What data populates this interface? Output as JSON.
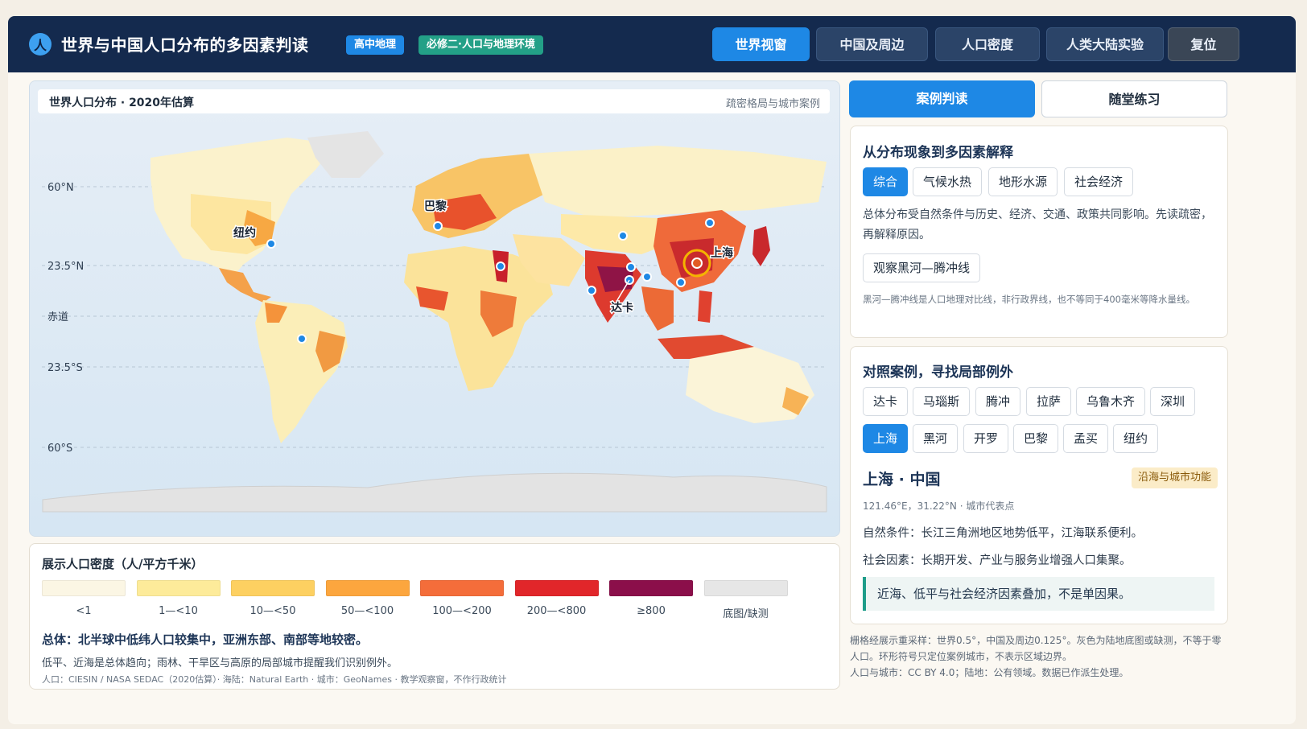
{
  "header": {
    "logo_glyph": "人",
    "title": "世界与中国人口分布的多因素判读",
    "badge_grade": "高中地理",
    "badge_unit": "必修二·人口与地理环境",
    "nav": [
      "世界视窗",
      "中国及周边",
      "人口密度",
      "人类大陆实验"
    ],
    "reset": "复位"
  },
  "map": {
    "title": "世界人口分布 · 2020年估算",
    "subtitle": "疏密格局与城市案例",
    "lat_labels": [
      "60°N",
      "23.5°N",
      "赤道",
      "23.5°S",
      "60°S"
    ],
    "city_labels": [
      "巴黎",
      "纽约",
      "上海",
      "达卡"
    ]
  },
  "legend": {
    "title": "展示人口密度（人/平方千米）",
    "classes": [
      {
        "label": "<1",
        "color": "#fbf6e4"
      },
      {
        "label": "1—<10",
        "color": "#fdeb9a"
      },
      {
        "label": "10—<50",
        "color": "#fdd061"
      },
      {
        "label": "50—<100",
        "color": "#fca63e"
      },
      {
        "label": "100—<200",
        "color": "#f46d3a"
      },
      {
        "label": "200—<800",
        "color": "#e1262a"
      },
      {
        "label": "≥800",
        "color": "#8b0f4a"
      },
      {
        "label": "底图/缺测",
        "color": "#e6e6e6"
      }
    ],
    "summary": "总体：北半球中低纬人口较集中，亚洲东部、南部等地较密。",
    "note": "低平、近海是总体趋向；雨林、干旱区与高原的局部城市提醒我们识别例外。",
    "source": "人口：CIESIN / NASA SEDAC（2020估算）· 海陆：Natural Earth · 城市：GeoNames · 教学观察窗，不作行政统计"
  },
  "tabs": {
    "active": "案例判读",
    "other": "随堂练习"
  },
  "factors": {
    "title": "从分布现象到多因素解释",
    "chips": [
      "综合",
      "气候水热",
      "地形水源",
      "社会经济"
    ],
    "text": "总体分布受自然条件与历史、经济、交通、政策共同影响。先读疏密，再解释原因。",
    "button": "观察黑河—腾冲线",
    "note": "黑河—腾冲线是人口地理对比线，非行政界线，也不等同于400毫米等降水量线。"
  },
  "cases": {
    "title": "对照案例，寻找局部例外",
    "row1": [
      "达卡",
      "马瑙斯",
      "腾冲",
      "拉萨",
      "乌鲁木齐",
      "深圳"
    ],
    "row2": [
      "上海",
      "黑河",
      "开罗",
      "巴黎",
      "孟买",
      "纽约"
    ],
    "name": "上海 · 中国",
    "tag": "沿海与城市功能",
    "coord": "121.46°E，31.22°N · 城市代表点",
    "nature": "自然条件：长江三角洲地区地势低平，江海联系便利。",
    "society": "社会因素：长期开发、产业与服务业增强人口集聚。",
    "quote": "近海、低平与社会经济因素叠加，不是单因果。"
  },
  "footnote": {
    "line1": "栅格经展示重采样：世界0.5°，中国及周边0.125°。灰色为陆地底图或缺测，不等于零人口。环形符号只定位案例城市，不表示区域边界。",
    "line2": "人口与城市：CC BY 4.0；陆地：公有领域。数据已作派生处理。"
  }
}
